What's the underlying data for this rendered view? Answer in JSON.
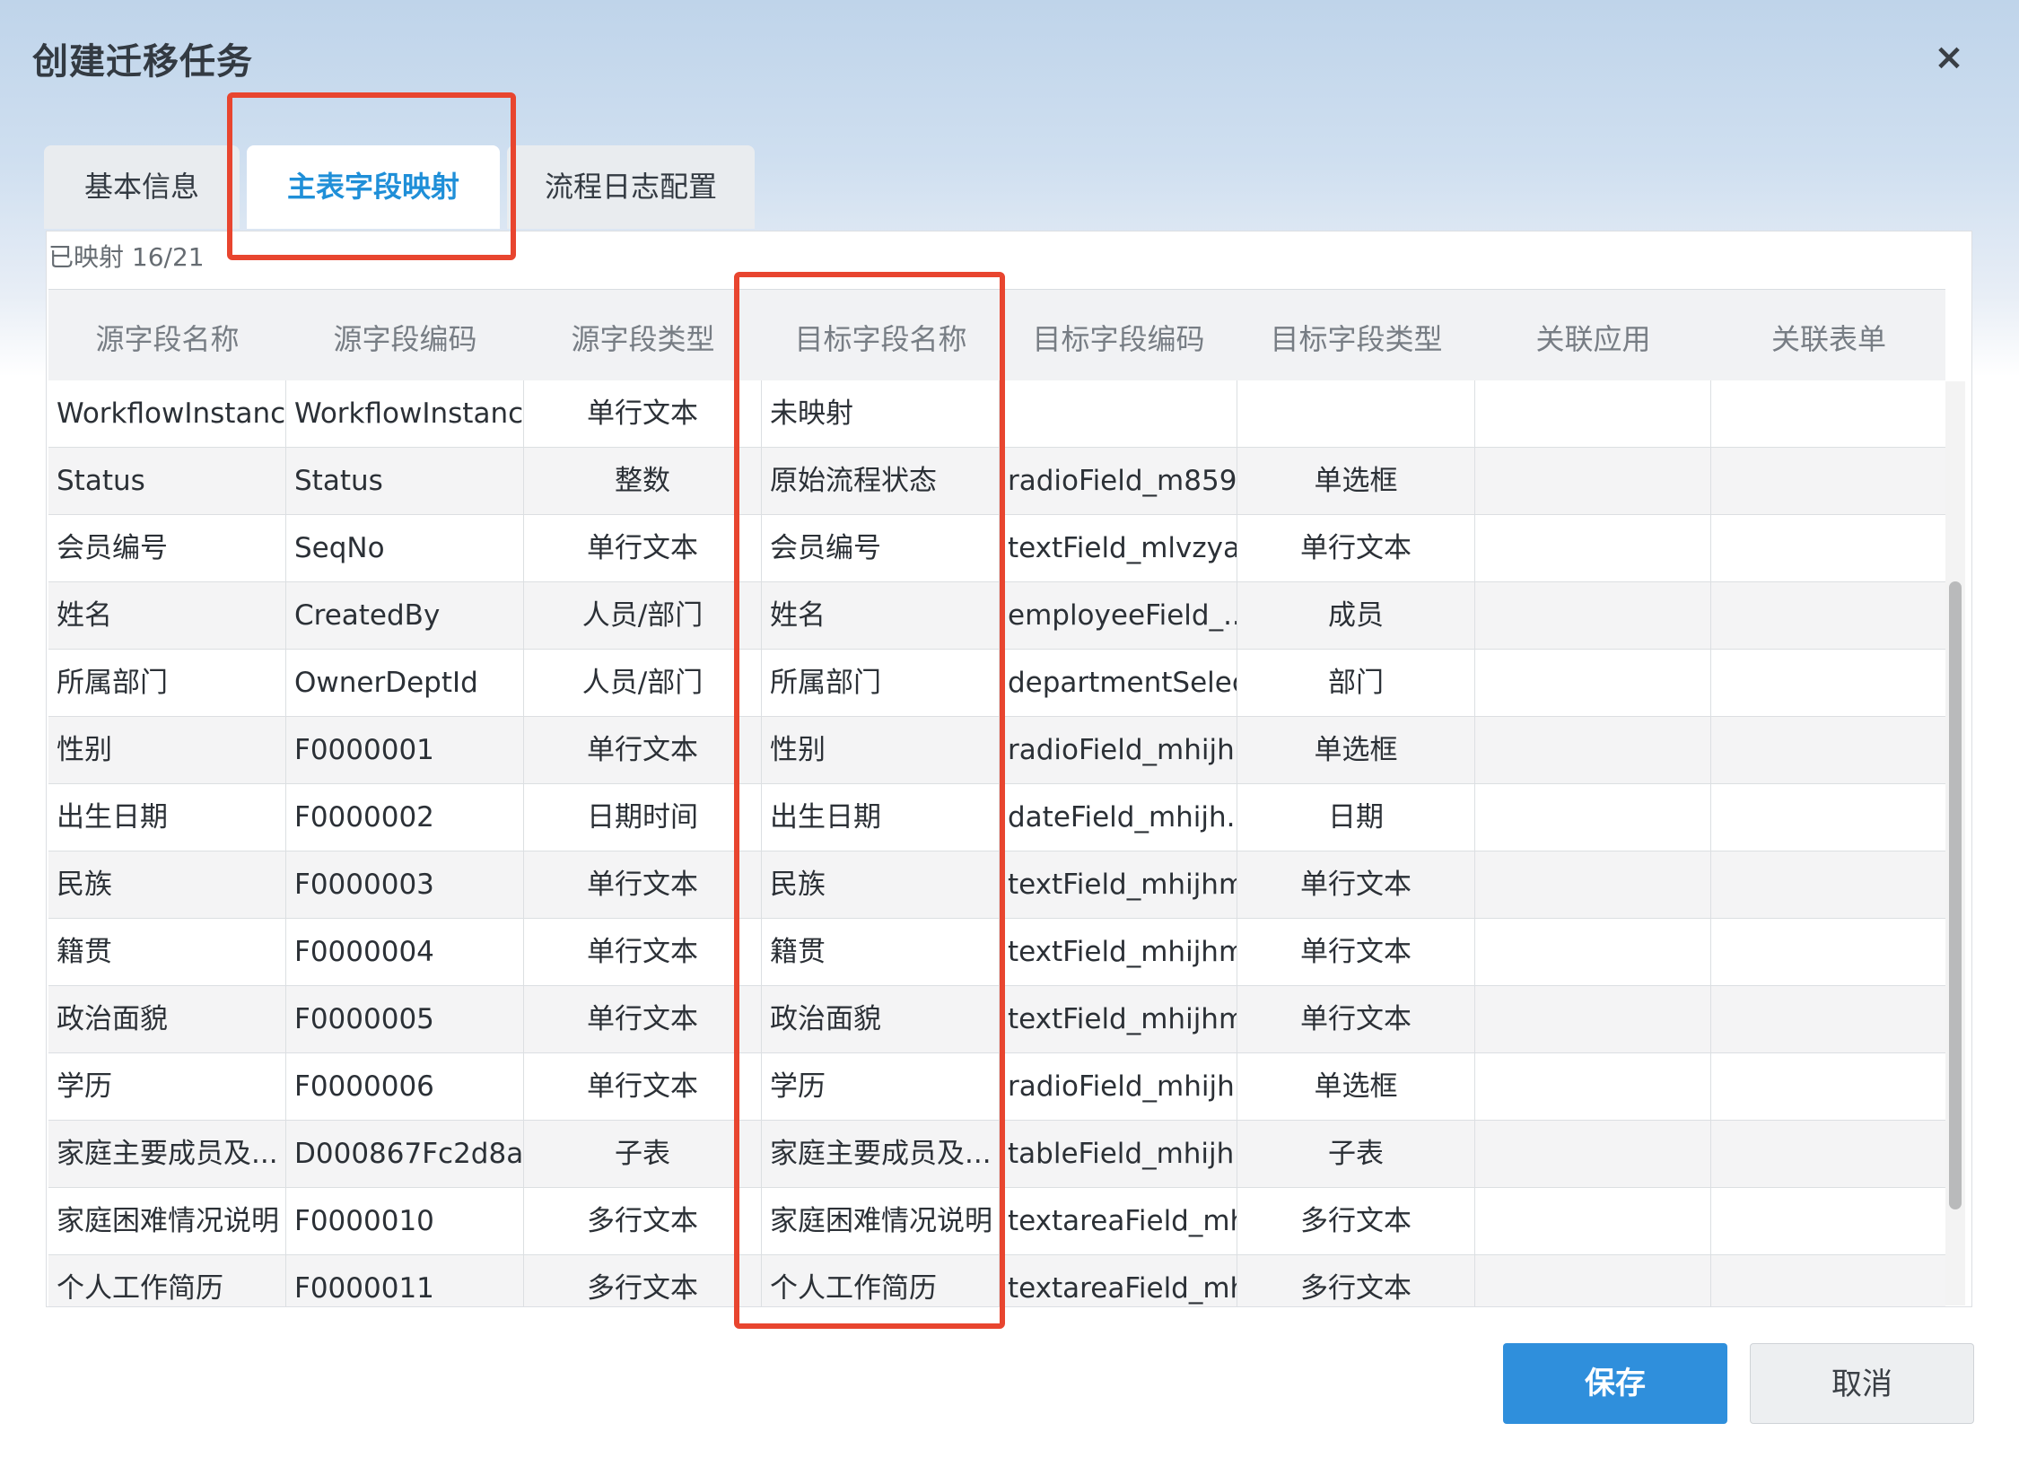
{
  "dialog": {
    "title": "创建迁移任务",
    "close": "×"
  },
  "tabs": [
    {
      "label": "基本信息",
      "active": false
    },
    {
      "label": "主表字段映射",
      "active": true
    },
    {
      "label": "流程日志配置",
      "active": false
    }
  ],
  "mapped_status": "已映射 16/21",
  "table": {
    "headers": [
      "源字段名称",
      "源字段编码",
      "源字段类型",
      "目标字段名称",
      "目标字段编码",
      "目标字段类型",
      "关联应用",
      "关联表单"
    ],
    "rows": [
      [
        "WorkflowInstanc...",
        "WorkflowInstanc...",
        "单行文本",
        "未映射",
        "",
        "",
        "",
        ""
      ],
      [
        "Status",
        "Status",
        "整数",
        "原始流程状态",
        "radioField_m859...",
        "单选框",
        "",
        ""
      ],
      [
        "会员编号",
        "SeqNo",
        "单行文本",
        "会员编号",
        "textField_mlvzya...",
        "单行文本",
        "",
        ""
      ],
      [
        "姓名",
        "CreatedBy",
        "人员/部门",
        "姓名",
        "employeeField_...",
        "成员",
        "",
        ""
      ],
      [
        "所属部门",
        "OwnerDeptId",
        "人员/部门",
        "所属部门",
        "departmentSelec...",
        "部门",
        "",
        ""
      ],
      [
        "性别",
        "F0000001",
        "单行文本",
        "性别",
        "radioField_mhijh...",
        "单选框",
        "",
        ""
      ],
      [
        "出生日期",
        "F0000002",
        "日期时间",
        "出生日期",
        "dateField_mhijh...",
        "日期",
        "",
        ""
      ],
      [
        "民族",
        "F0000003",
        "单行文本",
        "民族",
        "textField_mhijhm...",
        "单行文本",
        "",
        ""
      ],
      [
        "籍贯",
        "F0000004",
        "单行文本",
        "籍贯",
        "textField_mhijhm...",
        "单行文本",
        "",
        ""
      ],
      [
        "政治面貌",
        "F0000005",
        "单行文本",
        "政治面貌",
        "textField_mhijhm...",
        "单行文本",
        "",
        ""
      ],
      [
        "学历",
        "F0000006",
        "单行文本",
        "学历",
        "radioField_mhijh...",
        "单选框",
        "",
        ""
      ],
      [
        "家庭主要成员及...",
        "D000867Fc2d8a...",
        "子表",
        "家庭主要成员及...",
        "tableField_mhijh...",
        "子表",
        "",
        ""
      ],
      [
        "家庭困难情况说明",
        "F0000010",
        "多行文本",
        "家庭困难情况说明",
        "textareaField_mh...",
        "多行文本",
        "",
        ""
      ],
      [
        "个人工作简历",
        "F0000011",
        "多行文本",
        "个人工作简历",
        "textareaField_mh...",
        "多行文本",
        "",
        ""
      ]
    ]
  },
  "buttons": {
    "save": "保存",
    "cancel": "取消"
  },
  "colors": {
    "accent": "#2f8fdc",
    "highlight": "#e8452f",
    "active_tab_text": "#1f8fd8"
  }
}
